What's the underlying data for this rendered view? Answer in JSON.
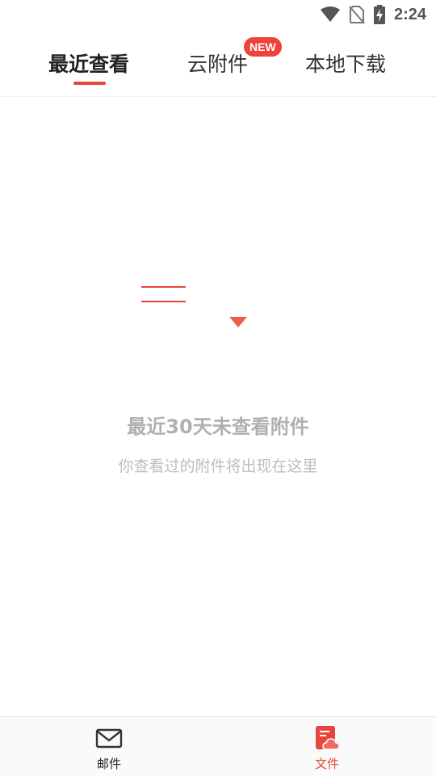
{
  "status_bar": {
    "time": "2:24",
    "icons": [
      "wifi-icon",
      "no-sim-icon",
      "battery-charging-icon"
    ]
  },
  "tabs": [
    {
      "label": "最近查看",
      "active": true
    },
    {
      "label": "云附件",
      "badge": "NEW",
      "active": false
    },
    {
      "label": "本地下载",
      "active": false
    }
  ],
  "empty_state": {
    "title": "最近30天未查看附件",
    "subtitle": "你查看过的附件将出现在这里"
  },
  "bottom_nav": [
    {
      "label": "邮件",
      "icon": "mail-icon",
      "active": false
    },
    {
      "label": "文件",
      "icon": "cloud-file-icon",
      "active": true
    }
  ],
  "colors": {
    "accent": "#e8453c",
    "badge": "#f0413b",
    "muted_text": "#b0b0b0"
  }
}
